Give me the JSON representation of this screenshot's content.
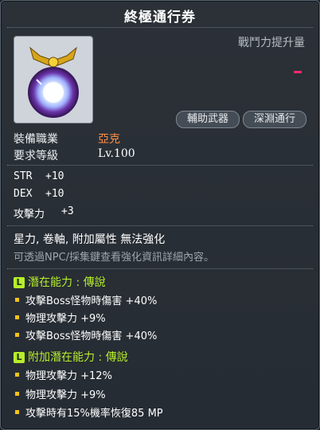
{
  "title": "終極通行券",
  "stat_boost_label": "戰鬥力提升量",
  "tags": [
    "輔助武器",
    "深淵通行"
  ],
  "requirements": {
    "job_label": "裝備職業",
    "job_value": "亞克",
    "level_label": "要求等級",
    "level_value": "Lv.100"
  },
  "stats": [
    {
      "name": "STR",
      "value": "+10"
    },
    {
      "name": "DEX",
      "value": "+10"
    },
    {
      "name": "攻擊力",
      "value": "+3"
    }
  ],
  "notes": {
    "restriction": "星力, 卷軸, 附加屬性 無法強化",
    "hint": "可透過NPC/採集鍵查看強化資訊詳細內容。"
  },
  "potential": {
    "badge": "L",
    "header": "潛在能力 : 傳說",
    "lines": [
      "攻擊Boss怪物時傷害 +40%",
      "物理攻擊力 +9%",
      "攻擊Boss怪物時傷害 +40%"
    ]
  },
  "bonus_potential": {
    "badge": "L",
    "header": "附加潛在能力 : 傳說",
    "lines": [
      "物理攻擊力 +12%",
      "物理攻擊力 +9%",
      "攻擊時有15%機率恢復85 MP"
    ]
  },
  "colors": {
    "background": "#2b3137",
    "job": "#ff8c46",
    "potential": "#b6ee2a",
    "bullet": "#f6c21a",
    "stat_dash": "#ff2a6a"
  },
  "icons": {
    "item": "pendant-orb-icon"
  }
}
